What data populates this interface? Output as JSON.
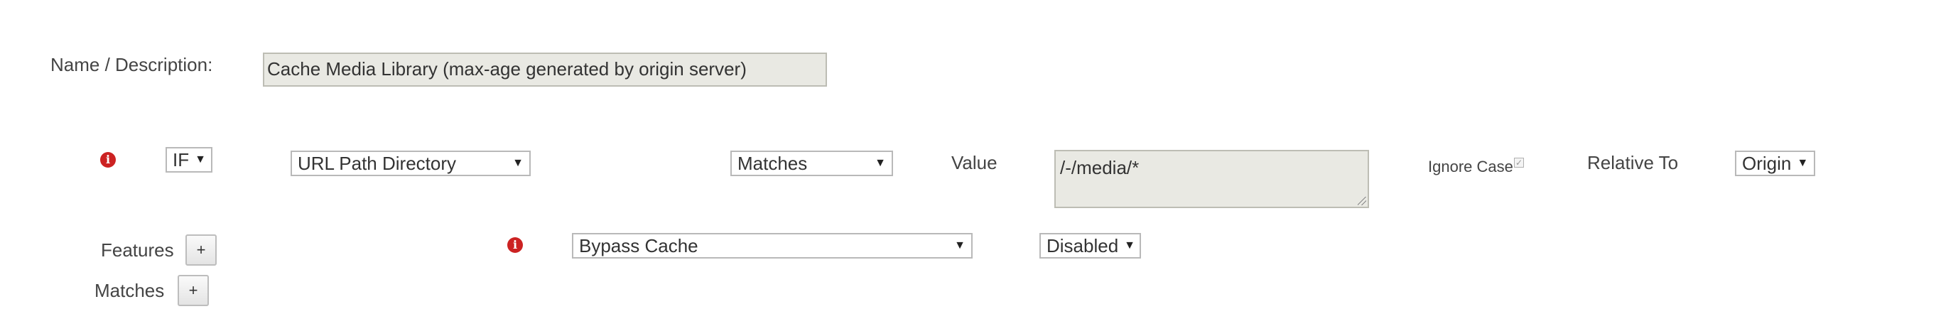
{
  "rule": {
    "name_label": "Name / Description:",
    "name_value": "Cache Media Library (max-age generated by origin server)"
  },
  "condition": {
    "info_icon": "info-icon",
    "if_select": "IF",
    "field_select": "URL Path Directory",
    "operator_select": "Matches",
    "value_label": "Value",
    "value_text": "/-/media/*",
    "ignore_case_label": "Ignore Case",
    "ignore_case_checked": true,
    "relative_to_label": "Relative To",
    "relative_to_select": "Origin"
  },
  "features": {
    "label": "Features",
    "add_label": "+",
    "info_icon": "info-icon",
    "feature_select": "Bypass Cache",
    "state_select": "Disabled"
  },
  "matches": {
    "label": "Matches",
    "add_label": "+"
  },
  "colors": {
    "info_icon": "#cc2222",
    "field_background": "#e9e9e3",
    "text": "#444444"
  }
}
